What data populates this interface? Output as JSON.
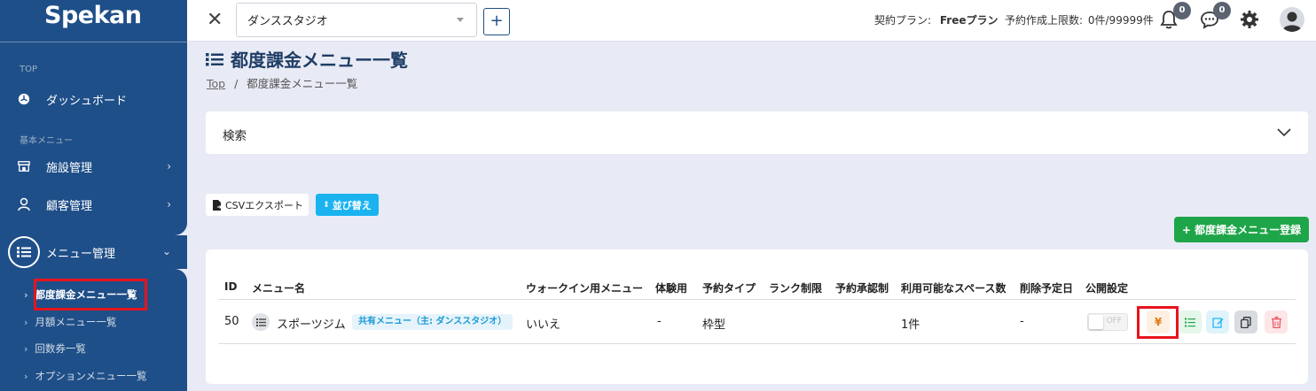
{
  "sidebar": {
    "logo": "Spekan",
    "section_top": "TOP",
    "dashboard": "ダッシュボード",
    "section_basic": "基本メニュー",
    "facility": "施設管理",
    "customer": "顧客管理",
    "menu_mgmt": "メニュー管理",
    "sub_items": [
      "都度課金メニュー一覧",
      "月額メニュー一覧",
      "回数券一覧",
      "オプションメニュー一覧"
    ]
  },
  "topbar": {
    "studio": "ダンススタジオ",
    "plus": "+",
    "plan_label": "契約プラン:",
    "plan_value": "Freeプラン",
    "limit_label": "予約作成上限数:",
    "limit_value": "0件/99999件",
    "notif_count": "0",
    "chat_count": "0"
  },
  "page": {
    "title": "都度課金メニュー一覧",
    "breadcrumb_top": "Top",
    "breadcrumb_sep": "/",
    "breadcrumb_current": "都度課金メニュー一覧",
    "search_label": "検索",
    "csv_button": "CSVエクスポート",
    "sort_button": "並び替え",
    "add_button": "+ 都度課金メニュー登録"
  },
  "table": {
    "headers": [
      "ID",
      "メニュー名",
      "ウォークイン用メニュー",
      "体験用",
      "予約タイプ",
      "ランク制限",
      "予約承認制",
      "利用可能なスペース数",
      "削除予定日",
      "公開設定"
    ],
    "row": {
      "id": "50",
      "name": "スポーツジム",
      "shared_tag": "共有メニュー（主: ダンススタジオ）",
      "walkin": "いいえ",
      "trial": "-",
      "type": "枠型",
      "rank": "",
      "approval": "",
      "spaces": "1件",
      "delete_date": "-",
      "toggle_label": "OFF",
      "yen": "¥"
    }
  },
  "colors": {
    "sidebar": "#1f4f88",
    "accent_green": "#1fa549",
    "accent_blue": "#1ab3f0",
    "highlight_red": "#e8141d"
  }
}
